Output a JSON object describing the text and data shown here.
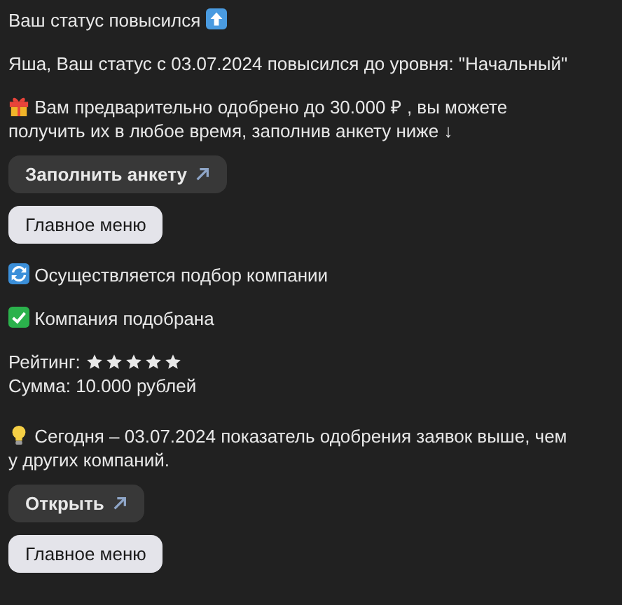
{
  "blocks": [
    {
      "kind": "heading",
      "text": "Ваш статус повысился"
    },
    {
      "kind": "text",
      "text": "Яша, Ваш статус с 03.07.2024 повысился до уровня: \"Начальный\""
    },
    {
      "kind": "offer",
      "text": "Вам предварительно одобрено до 30.000 ₽ , вы можете получить их в любое время, заполнив анкету ниже ↓"
    },
    {
      "kind": "link_button",
      "label": "Заполнить анкету"
    },
    {
      "kind": "menu_button",
      "label": "Главное меню"
    },
    {
      "kind": "progress",
      "text": "Осуществляется подбор компании"
    },
    {
      "kind": "done",
      "text": "Компания подобрана"
    },
    {
      "kind": "details",
      "rating_label": "Рейтинг:",
      "stars": 5,
      "amount": "Сумма: 10.000 рублей"
    },
    {
      "kind": "tip",
      "text": "Сегодня – 03.07.2024 показатель одобрения заявок выше, чем у других компаний."
    },
    {
      "kind": "link_button",
      "label": "Открыть"
    },
    {
      "kind": "menu_button",
      "label": "Главное меню"
    }
  ]
}
